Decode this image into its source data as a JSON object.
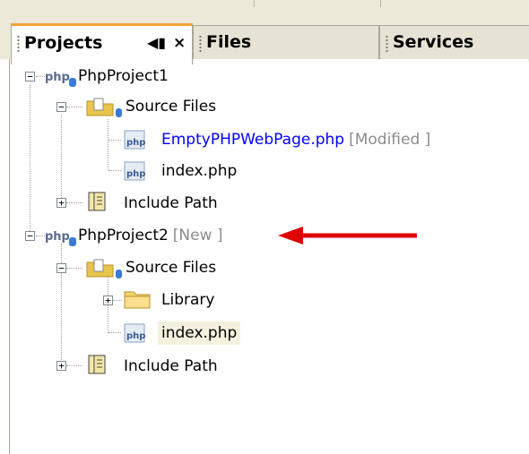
{
  "tabs": [
    {
      "label": "Projects",
      "active": true
    },
    {
      "label": "Files",
      "active": false
    },
    {
      "label": "Services",
      "active": false
    }
  ],
  "tree": {
    "project1": {
      "name": "PhpProject1",
      "source_files": "Source Files",
      "files": [
        {
          "name": "EmptyPHPWebPage.php",
          "status": "[Modified ]"
        },
        {
          "name": "index.php"
        }
      ],
      "include_path": "Include Path"
    },
    "project2": {
      "name": "PhpProject2",
      "status": "[New ]",
      "source_files": "Source Files",
      "library": "Library",
      "file": "index.php",
      "include_path": "Include Path"
    }
  },
  "icons": {
    "php_project": "php",
    "php_file": "php"
  },
  "colors": {
    "active_tab_accent": "#f0a436",
    "modified_text": "#0000ff",
    "status_text": "#8c8c8c",
    "arrow": "#e00000",
    "selection": "#f4f1de"
  }
}
